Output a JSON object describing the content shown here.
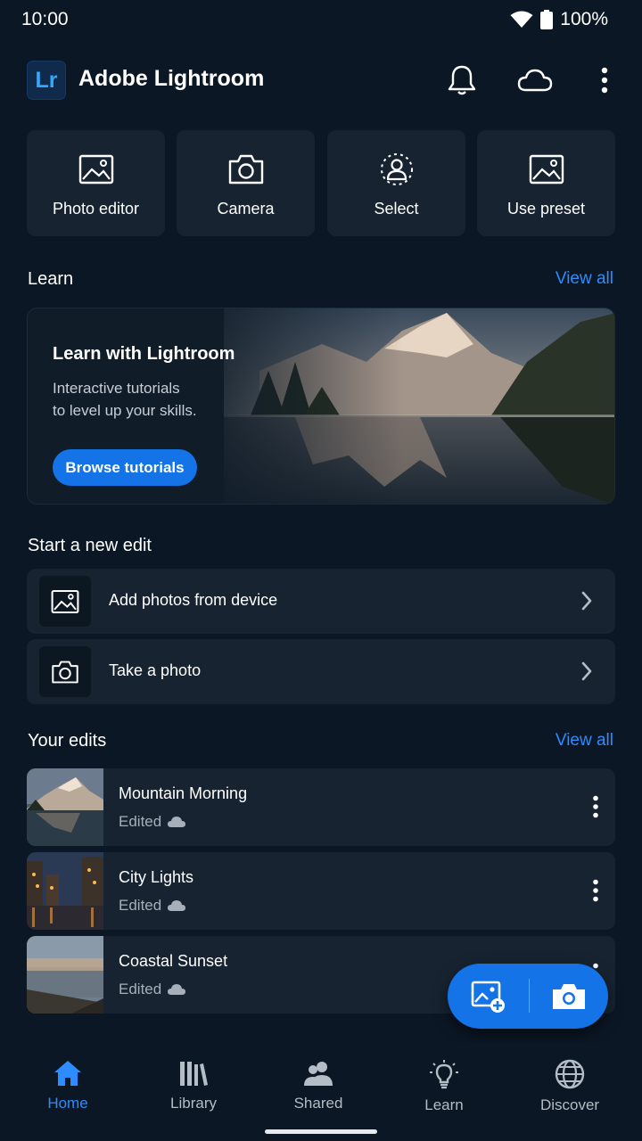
{
  "status_bar": {
    "time": "10:00",
    "battery": "100%"
  },
  "app_bar": {
    "logo_text": "Lr",
    "title": "Adobe Lightroom"
  },
  "quick_actions": [
    {
      "label": "Photo editor",
      "icon": "image-icon"
    },
    {
      "label": "Camera",
      "icon": "camera-icon"
    },
    {
      "label": "Select",
      "icon": "person-select-icon"
    },
    {
      "label": "Use preset",
      "icon": "image-icon"
    }
  ],
  "learn": {
    "section_title": "Learn",
    "view_all": "View all",
    "card_title": "Learn with Lightroom",
    "card_line1": "Interactive tutorials",
    "card_line2": "to level up your skills.",
    "button": "Browse tutorials"
  },
  "new_edit": {
    "section_title": "Start a new edit",
    "items": [
      {
        "label": "Add photos from device",
        "icon": "image-icon"
      },
      {
        "label": "Take a photo",
        "icon": "camera-icon"
      }
    ]
  },
  "your_edits": {
    "section_title": "Your edits",
    "view_all": "View all",
    "items": [
      {
        "name": "Mountain Morning",
        "status": "Edited"
      },
      {
        "name": "City Lights",
        "status": "Edited"
      },
      {
        "name": "Coastal Sunset",
        "status": "Edited"
      }
    ]
  },
  "bottom_nav": [
    {
      "label": "Home",
      "icon": "home-icon",
      "active": true
    },
    {
      "label": "Library",
      "icon": "library-icon",
      "active": false
    },
    {
      "label": "Shared",
      "icon": "people-icon",
      "active": false
    },
    {
      "label": "Learn",
      "icon": "lightbulb-icon",
      "active": false
    },
    {
      "label": "Discover",
      "icon": "globe-icon",
      "active": false
    }
  ],
  "colors": {
    "background": "#0b1724",
    "card": "#172331",
    "accent": "#1473e6",
    "link": "#2d8cff"
  }
}
